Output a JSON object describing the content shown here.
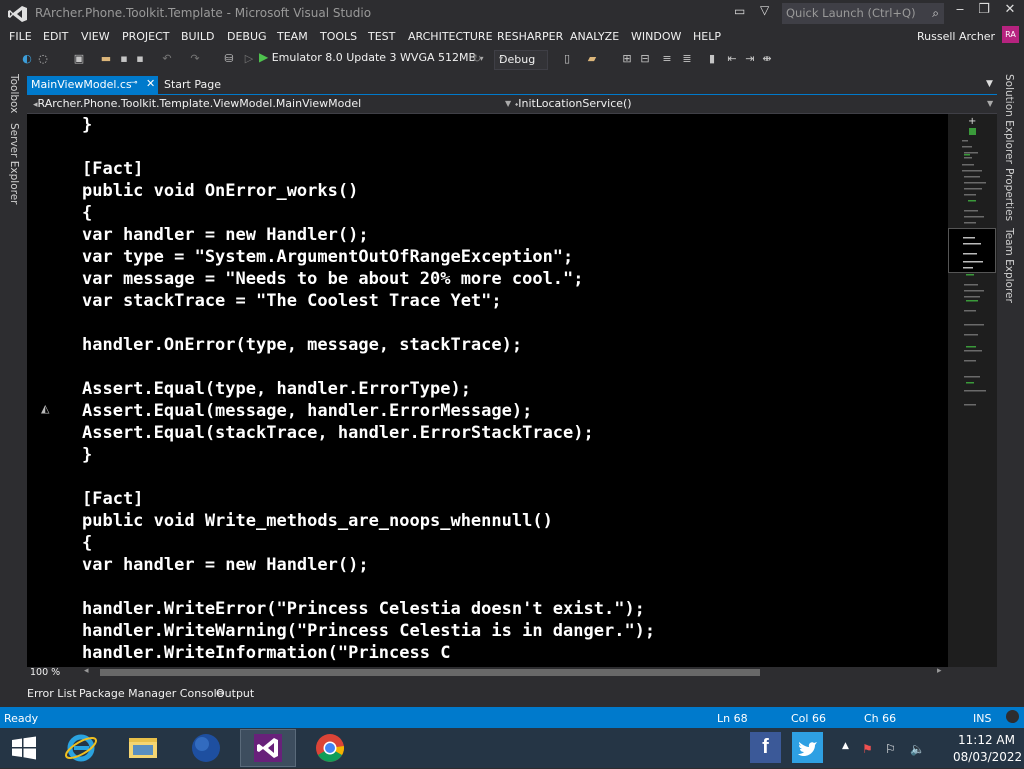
{
  "window": {
    "title": "RArcher.Phone.Toolkit.Template - Microsoft Visual Studio",
    "quick_launch_placeholder": "Quick Launch (Ctrl+Q)"
  },
  "menu": [
    "FILE",
    "EDIT",
    "VIEW",
    "PROJECT",
    "BUILD",
    "DEBUG",
    "TEAM",
    "TOOLS",
    "TEST",
    "ARCHITECTURE",
    "RESHARPER",
    "ANALYZE",
    "WINDOW",
    "HELP"
  ],
  "user": {
    "name": "Russell Archer",
    "initials": "RA",
    "accent": "#b6237f"
  },
  "toolbar": {
    "run_target": "Emulator 8.0 Update 3 WVGA 512MB",
    "configuration": "Debug"
  },
  "left_rail": {
    "toolbox": "Toolbox",
    "server_explorer": "Server Explorer"
  },
  "right_rail": {
    "solution_explorer": "Solution Explorer",
    "properties": "Properties",
    "team_explorer": "Team Explorer"
  },
  "tabs": {
    "active": "MainViewModel.cs",
    "inactive": "Start Page"
  },
  "navbar": {
    "type": "RArcher.Phone.Toolkit.Template.ViewModel.MainViewModel",
    "member": "InitLocationService()"
  },
  "code": [
    "}",
    "",
    "[Fact]",
    "public void OnError_works()",
    "{",
    "var handler = new Handler();",
    "var type = \"System.ArgumentOutOfRangeException\";",
    "var message = \"Needs to be about 20% more cool.\";",
    "var stackTrace = \"The Coolest Trace Yet\";",
    "",
    "handler.OnError(type, message, stackTrace);",
    "",
    "Assert.Equal(type, handler.ErrorType);",
    "Assert.Equal(message, handler.ErrorMessage);",
    "Assert.Equal(stackTrace, handler.ErrorStackTrace);",
    "}",
    "",
    "[Fact]",
    "public void Write_methods_are_noops_whennull()",
    "{",
    "var handler = new Handler();",
    "",
    "handler.WriteError(\"Princess Celestia doesn't exist.\");",
    "handler.WriteWarning(\"Princess Celestia is in danger.\");",
    "handler.WriteInformation(\"Princess C"
  ],
  "editor": {
    "zoom": "100 %"
  },
  "bottom_tabs": [
    "Error List",
    "Package Manager Console",
    "Output"
  ],
  "status": {
    "state": "Ready",
    "line": "Ln 68",
    "col": "Col 66",
    "ch": "Ch 66",
    "mode": "INS",
    "color": "#007acc"
  },
  "taskbar": {
    "time": "11:12 AM",
    "date": "08/03/2022",
    "apps": [
      "windows-start-icon",
      "internet-explorer-icon",
      "file-explorer-icon",
      "globe-icon",
      "visual-studio-icon",
      "chrome-icon"
    ]
  }
}
